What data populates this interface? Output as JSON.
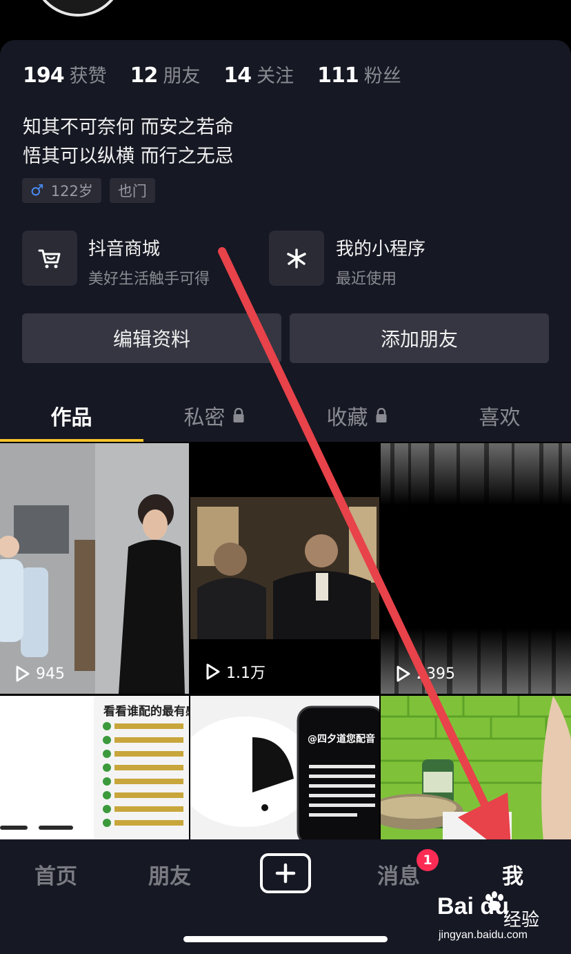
{
  "stats": [
    {
      "num": "194",
      "label": "获赞"
    },
    {
      "num": "12",
      "label": "朋友"
    },
    {
      "num": "14",
      "label": "关注"
    },
    {
      "num": "111",
      "label": "粉丝"
    }
  ],
  "bio": {
    "line1": "知其不可奈何 而安之若命",
    "line2": "悟其可以纵横 而行之无忌"
  },
  "tags": {
    "age": "122岁",
    "location": "也门"
  },
  "tiles": {
    "mall": {
      "title": "抖音商城",
      "subtitle": "美好生活触手可得"
    },
    "mini": {
      "title": "我的小程序",
      "subtitle": "最近使用"
    }
  },
  "buttons": {
    "edit": "编辑资料",
    "add_friend": "添加朋友"
  },
  "tabs": [
    {
      "label": "作品",
      "locked": false
    },
    {
      "label": "私密",
      "locked": true
    },
    {
      "label": "收藏",
      "locked": true
    },
    {
      "label": "喜欢",
      "locked": false
    }
  ],
  "videos": [
    {
      "plays": "945"
    },
    {
      "plays": "1.1万"
    },
    {
      "plays": "2395"
    },
    {
      "plays": "",
      "headline": "看看谁配的最有感"
    },
    {
      "plays": "",
      "caption": "@四夕道您配音"
    },
    {
      "plays": ""
    }
  ],
  "nav": {
    "home": "首页",
    "friends": "朋友",
    "messages": "消息",
    "messages_badge": "1",
    "me": "我"
  },
  "watermark": {
    "brand": "Bai du",
    "word": "经验",
    "url": "jingyan.baidu.com"
  },
  "colors": {
    "accent_underline": "#f9c52d",
    "badge": "#fe2c55",
    "annotation_arrow": "#e8424a"
  }
}
